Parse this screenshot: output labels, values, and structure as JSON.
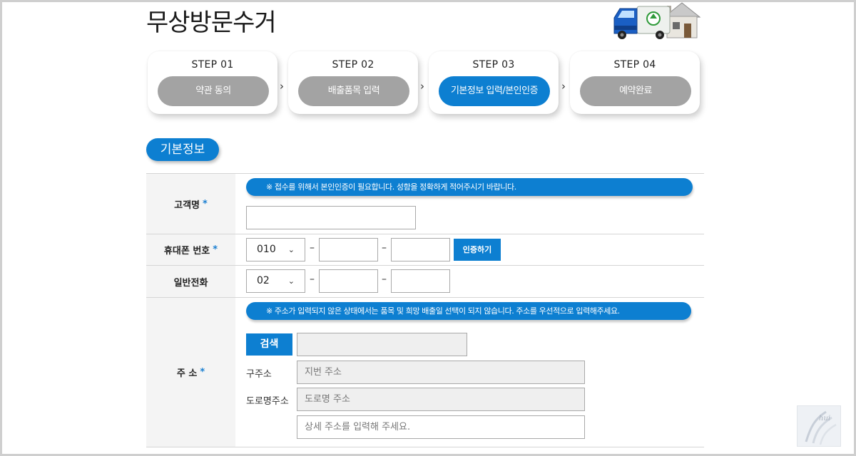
{
  "page_title": "무상방문수거",
  "steps": [
    {
      "no": "STEP 01",
      "label": "약관 동의",
      "active": false
    },
    {
      "no": "STEP 02",
      "label": "배출품목 입력",
      "active": false
    },
    {
      "no": "STEP 03",
      "label": "기본정보 입력/본인인증",
      "active": true
    },
    {
      "no": "STEP 04",
      "label": "예약완료",
      "active": false
    }
  ],
  "step_separator": "›",
  "section_title": "기본정보",
  "form": {
    "name": {
      "label": "고객명",
      "required_mark": "*",
      "notice": "※ 접수를 위해서 본인인증이 필요합니다. 성함을 정확하게 적어주시기 바랍니다.",
      "value": ""
    },
    "mobile": {
      "label": "휴대폰 번호",
      "required_mark": "*",
      "prefix_selected": "010",
      "dash": "–",
      "middle": "",
      "last": "",
      "verify_button": "인증하기"
    },
    "phone": {
      "label": "일반전화",
      "prefix_selected": "02",
      "dash": "–",
      "middle": "",
      "last": ""
    },
    "address": {
      "label": "주 소",
      "required_mark": "*",
      "notice": "※ 주소가 입력되지 않은 상태에서는 품목 및 희망 배출일 선택이 되지 않습니다. 주소를 우선적으로 입력해주세요.",
      "search_button": "검색",
      "zip_value": "",
      "old_address_label": "구주소",
      "old_address_placeholder": "지번 주소",
      "road_address_label": "도로명주소",
      "road_address_placeholder": "도로명 주소",
      "detail_placeholder": "상세 주소를 입력해 주세요."
    }
  },
  "watermark_text": "hui",
  "colors": {
    "accent": "#0d7fd1",
    "inactive_step": "#a3a3a3",
    "label_bg": "#f4f4f4",
    "readonly_bg": "#efefef"
  }
}
